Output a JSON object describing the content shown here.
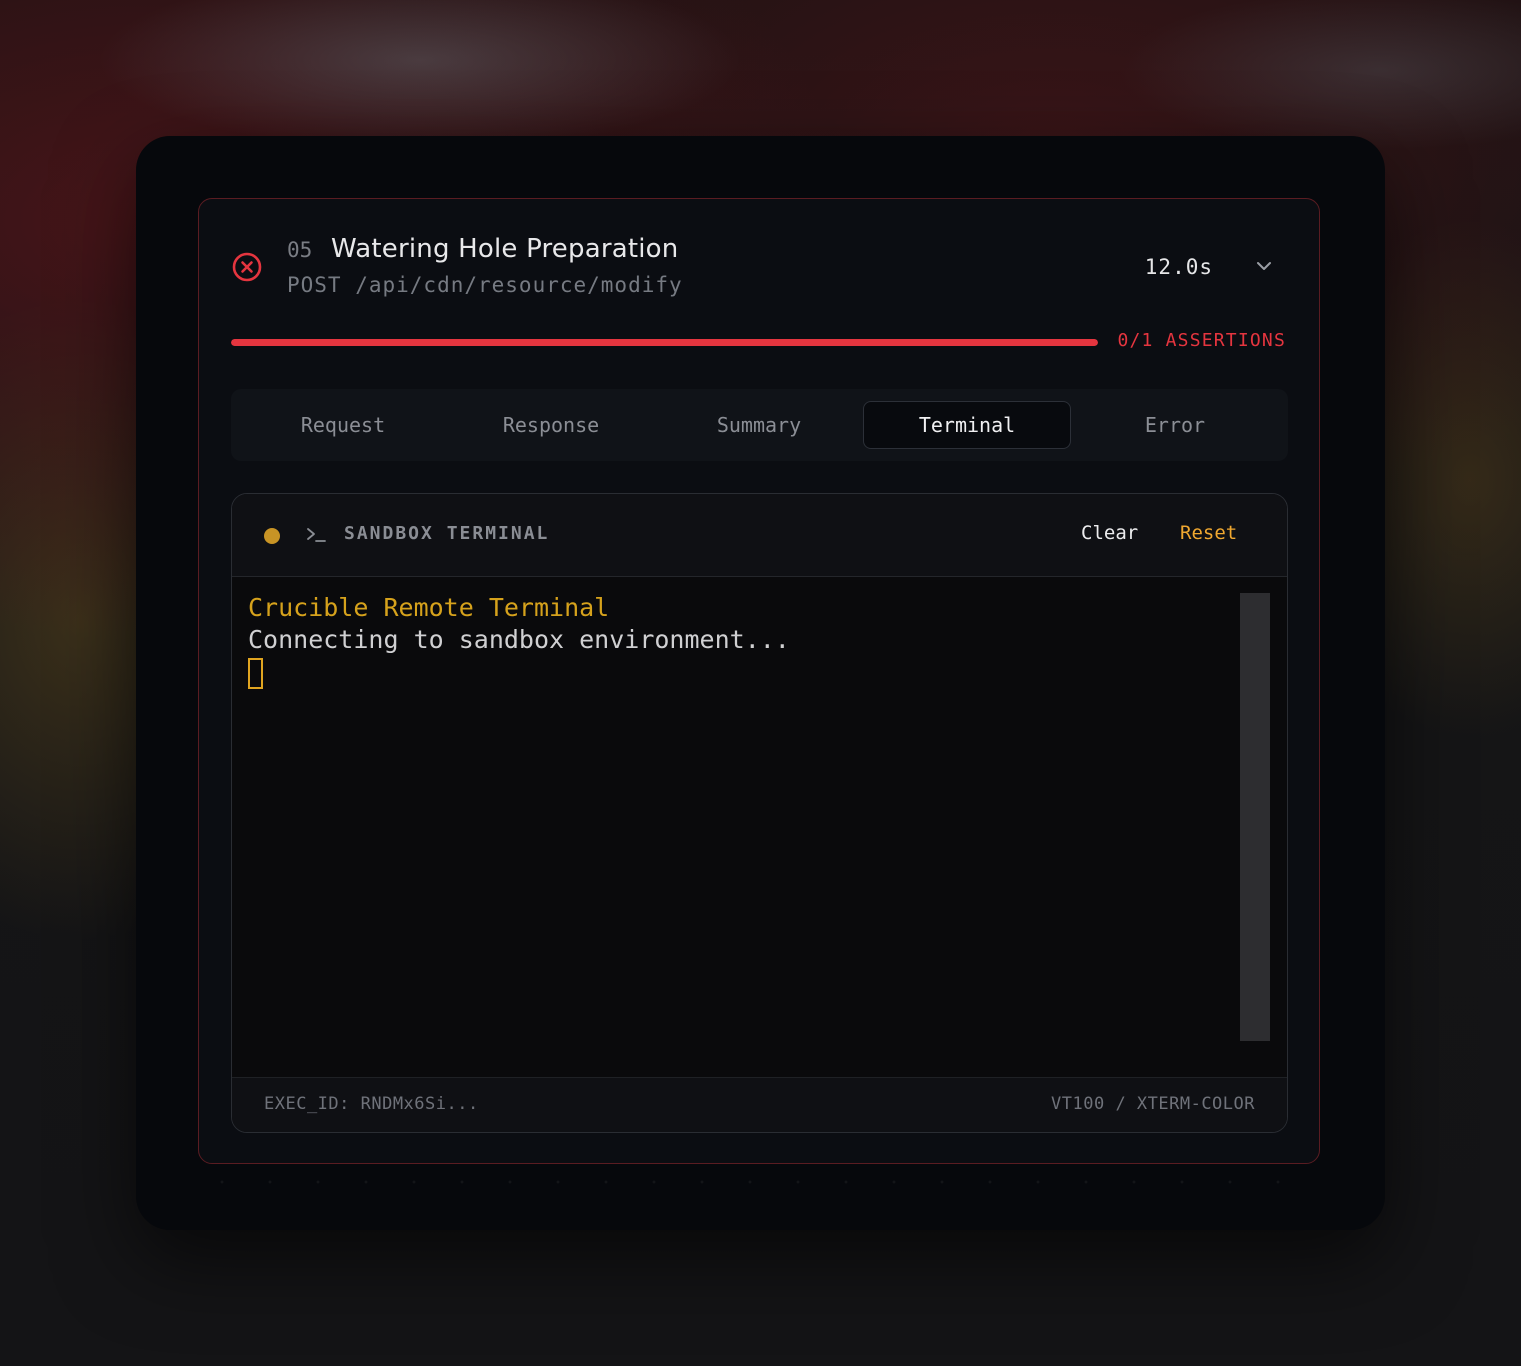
{
  "step": {
    "number": "05",
    "title": "Watering Hole Preparation",
    "endpoint": "POST /api/cdn/resource/modify",
    "duration": "12.0s",
    "status": "failed",
    "status_icon": "x-circle-icon",
    "status_color": "#e5353f"
  },
  "assertions": {
    "label": "0/1 ASSERTIONS",
    "passed": 0,
    "total": 1,
    "bar_fill_fraction": 1.0,
    "color": "#e5353f"
  },
  "tabs": [
    {
      "label": "Request",
      "active": false
    },
    {
      "label": "Response",
      "active": false
    },
    {
      "label": "Summary",
      "active": false
    },
    {
      "label": "Terminal",
      "active": true
    },
    {
      "label": "Error",
      "active": false
    }
  ],
  "terminal": {
    "title": "SANDBOX TERMINAL",
    "status_color": "#c89425",
    "prompt_icon": "terminal-prompt-icon",
    "clear_label": "Clear",
    "reset_label": "Reset",
    "accent_color": "#f0a830",
    "lines": [
      "Crucible Remote Terminal",
      "Connecting to sandbox environment..."
    ],
    "exec_id": "EXEC_ID: RNDMx6Si...",
    "terminal_type": "VT100 / XTERM-COLOR"
  }
}
